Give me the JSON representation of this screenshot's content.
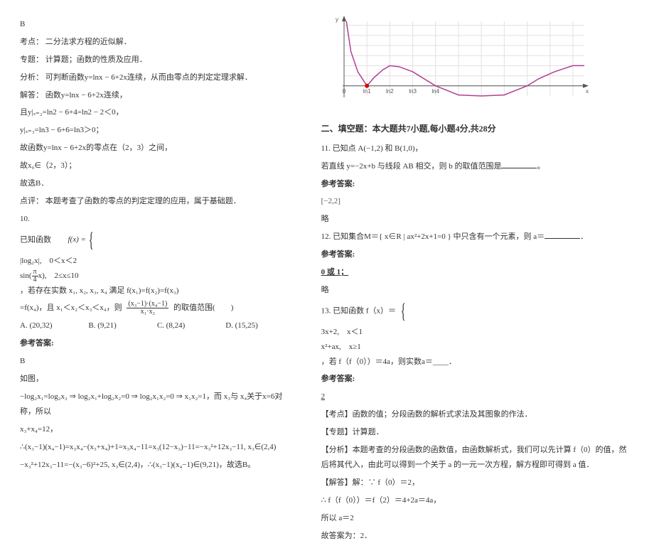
{
  "left": {
    "ansB": "B",
    "kp_label": "考点：",
    "kp": "二分法求方程的近似解．",
    "zt_label": "专题：",
    "zt": "计算题；函数的性质及应用．",
    "fx_label": "分析：",
    "fx": "可判断函数y=lnx − 6+2x连续，从而由零点的判定定理求解．",
    "jd_label": "解答：",
    "jd": "函数y=lnx − 6+2x连续，",
    "eq1": "且y|ₓ₌₂=ln2 − 6+4=ln2 − 2＜0，",
    "eq2": "y|ₓ₌₃=ln3 − 6+6=ln3＞0；",
    "eq3": "故函数y=lnx − 6+2x的零点在（2，3）之间，",
    "eq4": "故x₀∈（2，3）；",
    "eq5": "故选B．",
    "dp_label": "点评：",
    "dp": "本题考查了函数的零点的判定定理的应用，属于基础题．",
    "q10": "10.",
    "known": "已知函数",
    "fxdef_head": "f(x) =",
    "case1": "|log₂x|,　0＜x＜2",
    "case2_a": "sin(",
    "case2_frac_num": "π",
    "case2_frac_den": "4",
    "case2_b": "x),　2≤x≤10",
    "after": "，若存在实数 x₁, x₂, x₃, x₄ 满足 f(x₁)=f(x₂)=f(x₃)",
    "line2a": "=f(x₄)，且 x₁＜x₂＜x₃＜x₄，则",
    "frac2_num": "(x₃−1)·(x₄−1)",
    "frac2_den": "x₁·x₂",
    "line2b": "的取值范围(　　)",
    "optA": "A. (20,32)",
    "optB": "B. (9,21)",
    "optC": "C. (8,24)",
    "optD": "D. (15,25)",
    "ref": "参考答案:",
    "ansB2": "B",
    "asfig": "如图，",
    "proof1": "−log₂x₁=log₂x₂ ⇒ log₂x₁+log₂x₂=0 ⇒ log₂x₁x₂=0 ⇒ x₁x₂=1，而 x₃与 x₄关于x=6对称，所以",
    "proof2": "x₃+x₄=12，",
    "proof3": "∴(x₃−1)(x₄−1)=x₃x₄−(x₃+x₄)+1=x₃x₄−11=x₃(12−x₃)−11=−x₃²+12x₃−11, x₃∈(2,4)",
    "proof4": "−x₃²+12x₃−11=−(x₃−6)²+25, x₃∈(2,4)，∴(x₃−1)(x₄−1)∈(9,21)，故选B。"
  },
  "right": {
    "sec2": "二、填空题：本大题共7小题,每小题4分,共28分",
    "q11a": "11. 已知点 A(−1,2) 和 B(1,0)，",
    "q11b": "若直线 y=−2x+b 与线段 AB 相交，则 b 的取值范围是",
    "ref": "参考答案:",
    "ans11": "[−2,2]",
    "lue": "略",
    "q12": "12. 已知集合M＝{ x∈R | ax²+2x+1=0 } 中只含有一个元素，则 a＝",
    "ref12": "参考答案:",
    "ans12": "0 或 1；",
    "lue12": "略",
    "q13a": "13. 已知函数 f（x）＝",
    "case13a": "3x+2,　x＜1",
    "case13b": "x²+ax,　x≥1",
    "q13b": "，若 f（f（0））＝4a，则实数a＝____．",
    "ref13": "参考答案:",
    "ans13": "2",
    "kp13l": "【考点】",
    "kp13": "函数的值；分段函数的解析式求法及其图象的作法．",
    "zt13l": "【专题】",
    "zt13": "计算题．",
    "fx13l": "【分析】",
    "fx13": "本题考查的分段函数的函数值，由函数解析式，我们可以先计算 f（0）的值，然后将其代入，由此可以得到一个关于 a 的一元一次方程，解方程即可得到 a 值．",
    "jd13l": "【解答】",
    "jd13a": "解：∵ f（0）＝2，",
    "jd13b": "∴ f（f（0））＝f（2）＝4+2a＝4a，",
    "jd13c": "所以 a＝2",
    "jd13d": "故答案为：2．"
  },
  "chart_data": {
    "type": "line",
    "title": "",
    "xlabel": "x",
    "ylabel": "y",
    "xlim": [
      0,
      10.5
    ],
    "ylim": [
      -0.5,
      3.2
    ],
    "xticks": [
      0,
      1,
      2,
      3,
      4,
      5,
      6,
      7,
      8,
      9,
      10
    ],
    "xtick_labels": [
      "0",
      "ln1",
      "ln2",
      "ln3",
      "ln4",
      "",
      "",
      "",
      "",
      "",
      ""
    ],
    "curve_points": [
      [
        0.1,
        3.2
      ],
      [
        0.3,
        1.7
      ],
      [
        0.6,
        0.7
      ],
      [
        1.0,
        0.0
      ],
      [
        1.3,
        0.4
      ],
      [
        1.7,
        0.8
      ],
      [
        2.0,
        1.0
      ],
      [
        2.4,
        0.95
      ],
      [
        3.0,
        0.7
      ],
      [
        4.0,
        0.0
      ],
      [
        5.0,
        -0.45
      ],
      [
        6.0,
        -0.5
      ],
      [
        7.0,
        -0.45
      ],
      [
        8.0,
        0.0
      ],
      [
        8.5,
        0.35
      ],
      [
        9.2,
        0.7
      ],
      [
        10.0,
        1.0
      ],
      [
        10.5,
        1.0
      ]
    ],
    "red_point": [
      1.0,
      0.0
    ]
  }
}
